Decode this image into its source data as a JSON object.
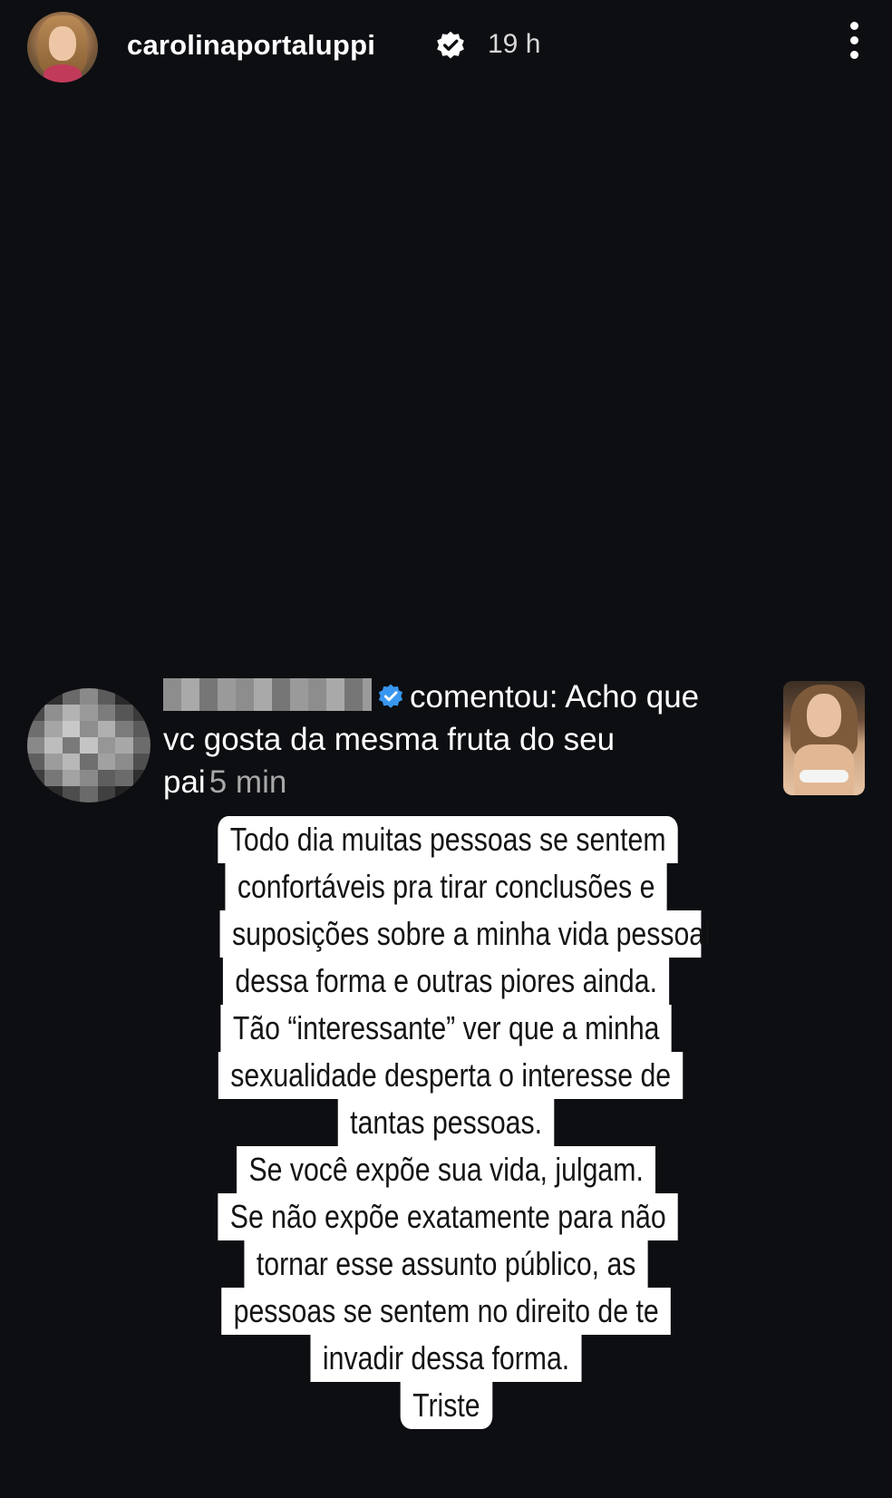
{
  "header": {
    "username": "carolinaportaluppi",
    "time": "19 h"
  },
  "comment": {
    "verb": "comentou:",
    "text_line1": "Acho que",
    "text_line2": "vc gosta da mesma fruta do seu",
    "text_line3": "pai",
    "time": "5 min"
  },
  "statement": {
    "lines": [
      "Todo dia muitas pessoas se sentem",
      "confortáveis pra tirar conclusões e",
      "suposições sobre a minha vida pessoal",
      "dessa forma e outras piores ainda.",
      "Tão “interessante” ver que a minha",
      "sexualidade desperta o interesse de",
      "tantas pessoas.",
      "Se você expõe sua vida, julgam.",
      "Se não expõe exatamente para não",
      "tornar esse assunto público, as",
      "pessoas se sentem no direito de te",
      "invadir dessa forma.",
      "Triste"
    ]
  },
  "colors": {
    "background": "#0d0e12",
    "verified_blue": "#3897f0",
    "text_highlight": "#ffffff"
  }
}
